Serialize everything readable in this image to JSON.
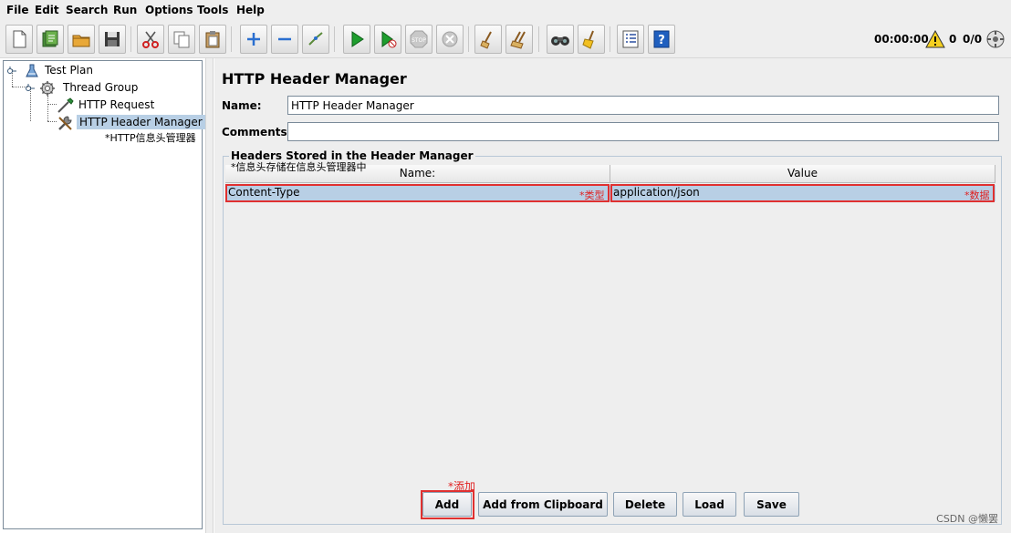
{
  "menu": [
    {
      "label": "File"
    },
    {
      "label": "Edit"
    },
    {
      "label": "Search"
    },
    {
      "label": "Run"
    },
    {
      "label": "Options"
    },
    {
      "label": "Tools"
    },
    {
      "label": "Help"
    }
  ],
  "toolbar": {
    "icons": [
      "new-icon",
      "templates-icon",
      "open-icon",
      "save-icon",
      "cut-icon",
      "copy-icon",
      "paste-icon",
      "expand-icon",
      "collapse-icon",
      "toggle-icon",
      "start-icon",
      "start-no-pause-icon",
      "stop-icon",
      "shutdown-icon",
      "clear-icon",
      "clear-all-icon",
      "search-icon",
      "reset-search-icon",
      "function-helper-icon",
      "help-icon"
    ],
    "status": {
      "timer": "00:00:00",
      "warnings": "0",
      "threads": "0/0"
    }
  },
  "tree": {
    "test_plan": "Test Plan",
    "thread_group": "Thread Group",
    "http_request": "HTTP Request",
    "http_header_manager": "HTTP Header Manager",
    "annotation": "*HTTP信息头管理器"
  },
  "panel": {
    "title": "HTTP Header Manager",
    "name_label": "Name:",
    "name_value": "HTTP Header Manager",
    "comments_label": "Comments:",
    "comments_value": "",
    "group_title": "Headers Stored in the Header Manager",
    "group_annotation": "*信息头存储在信息头管理器中"
  },
  "table": {
    "columns": [
      "Name:",
      "Value"
    ],
    "rows": [
      {
        "name": "Content-Type",
        "value": "application/json"
      }
    ],
    "name_annotation": "*类型",
    "value_annotation": "*数据"
  },
  "buttons": {
    "add_annotation": "*添加",
    "add": "Add",
    "add_from_clipboard": "Add from Clipboard",
    "delete": "Delete",
    "load": "Load",
    "save": "Save"
  },
  "watermark": "CSDN @懒罢"
}
